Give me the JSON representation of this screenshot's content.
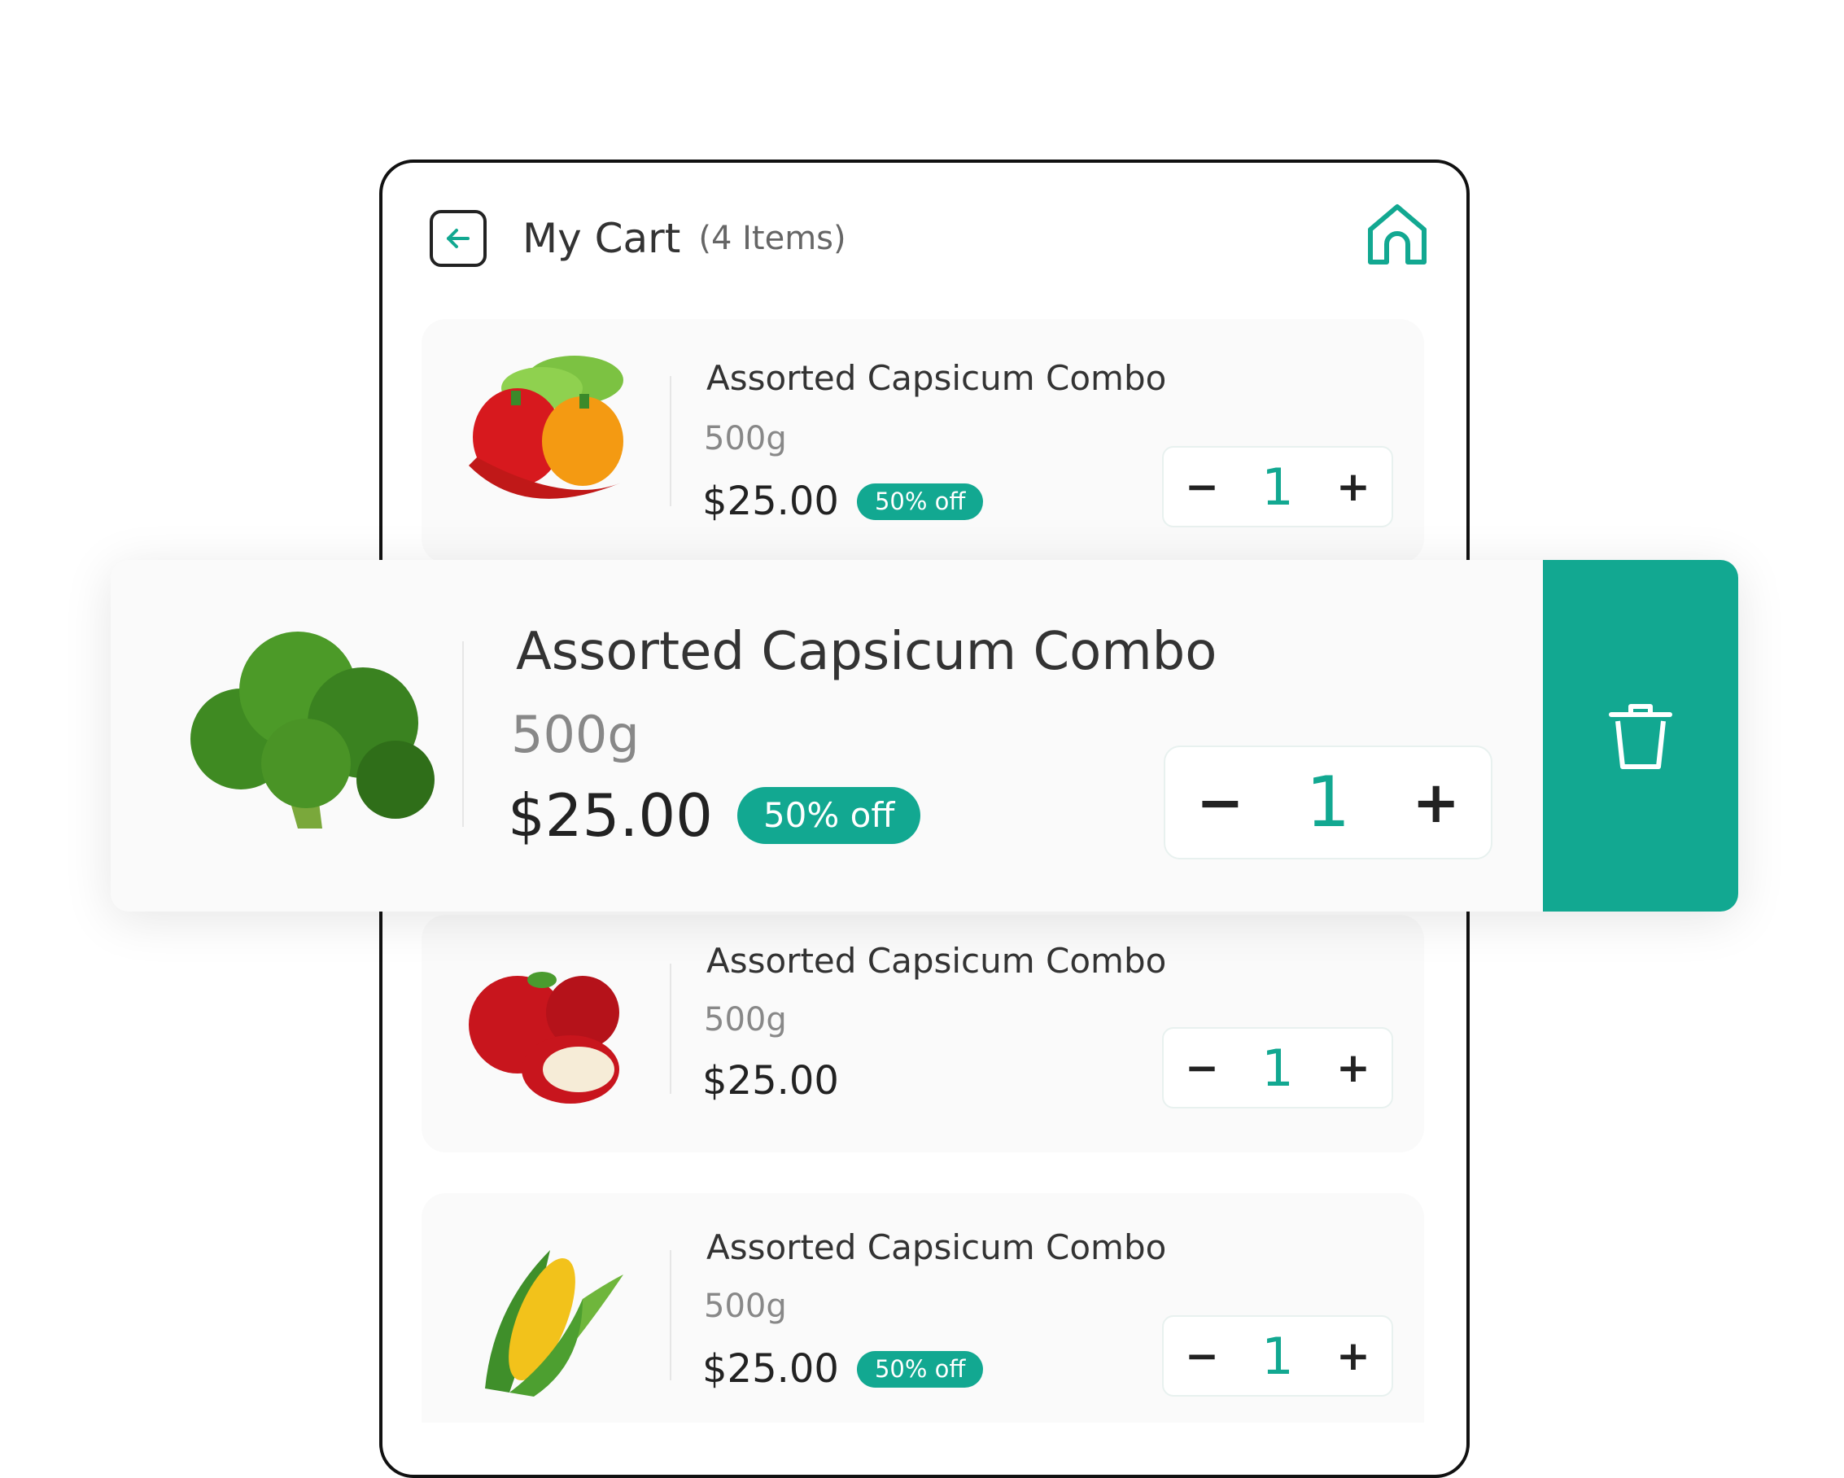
{
  "header": {
    "title": "My Cart",
    "count": "(4 Items)",
    "back_icon": "arrow-left-icon",
    "home_icon": "home-icon"
  },
  "accent_color": "#12a891",
  "items": [
    {
      "name": "Assorted Capsicum Combo",
      "weight": "500g",
      "price": "$25.00",
      "badge": "50% off",
      "quantity": "1",
      "minus": "−",
      "plus": "+",
      "image": "capsicum-image"
    },
    {
      "name": "Assorted Capsicum Combo",
      "weight": "500g",
      "price": "$25.00",
      "badge": "50% off",
      "quantity": "1",
      "minus": "−",
      "plus": "+",
      "image": "broccoli-image"
    },
    {
      "name": "Assorted Capsicum Combo",
      "weight": "500g",
      "price": "$25.00",
      "quantity": "1",
      "minus": "−",
      "plus": "+",
      "image": "apple-image"
    },
    {
      "name": "Assorted Capsicum Combo",
      "weight": "500g",
      "price": "$25.00",
      "badge": "50% off",
      "quantity": "1",
      "minus": "−",
      "plus": "+",
      "image": "corn-image"
    }
  ],
  "delete_icon": "trash-icon"
}
